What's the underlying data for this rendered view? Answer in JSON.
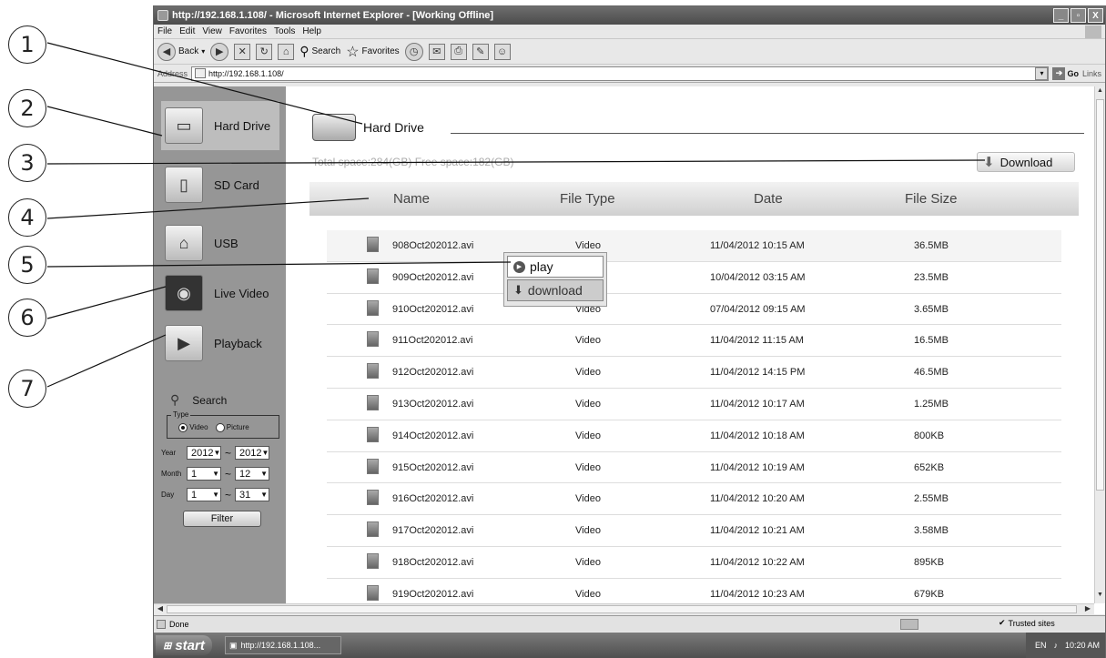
{
  "callouts": [
    "1",
    "2",
    "3",
    "4",
    "5",
    "6",
    "7"
  ],
  "window": {
    "title": "http://192.168.1.108/ - Microsoft Internet Explorer - [Working Offline]",
    "buttons": {
      "minimize": "_",
      "maximize": "▫",
      "close": "X"
    }
  },
  "menu": [
    "File",
    "Edit",
    "View",
    "Favorites",
    "Tools",
    "Help"
  ],
  "toolbar": {
    "back": "Back",
    "search": "Search",
    "favorites": "Favorites"
  },
  "address": {
    "label": "Address",
    "url": "http://192.168.1.108/",
    "go": "Go",
    "links": "Links"
  },
  "sidebar": {
    "items": [
      {
        "label": "Hard Drive",
        "icon": "hard-drive-icon"
      },
      {
        "label": "SD Card",
        "icon": "sd-card-icon"
      },
      {
        "label": "USB",
        "icon": "usb-icon"
      },
      {
        "label": "Live Video",
        "icon": "live-video-icon"
      },
      {
        "label": "Playback",
        "icon": "playback-icon"
      }
    ],
    "search": {
      "label": "Search",
      "type_legend": "Type",
      "type_options": [
        "Video",
        "Picture"
      ],
      "type_selected": "Video",
      "year_label": "Year",
      "year_from": "2012",
      "year_to": "2012",
      "month_label": "Month",
      "month_from": "1",
      "month_to": "12",
      "day_label": "Day",
      "day_from": "1",
      "day_to": "31",
      "range_sep": "~",
      "filter": "Filter"
    }
  },
  "main": {
    "title": "Hard Drive",
    "space": "Total space:284(GB) Free space:182(GB)",
    "download": "Download",
    "columns": [
      "Name",
      "File Type",
      "Date",
      "File Size"
    ],
    "rows": [
      {
        "name": "908Oct202012.avi",
        "type": "Video",
        "date": "11/04/2012 10:15 AM",
        "size": "36.5MB"
      },
      {
        "name": "909Oct202012.avi",
        "type": "Video",
        "date": "10/04/2012 03:15 AM",
        "size": "23.5MB"
      },
      {
        "name": "910Oct202012.avi",
        "type": "Video",
        "date": "07/04/2012 09:15 AM",
        "size": "3.65MB"
      },
      {
        "name": "911Oct202012.avi",
        "type": "Video",
        "date": "11/04/2012 11:15 AM",
        "size": "16.5MB"
      },
      {
        "name": "912Oct202012.avi",
        "type": "Video",
        "date": "11/04/2012 14:15 PM",
        "size": "46.5MB"
      },
      {
        "name": "913Oct202012.avi",
        "type": "Video",
        "date": "11/04/2012 10:17 AM",
        "size": "1.25MB"
      },
      {
        "name": "914Oct202012.avi",
        "type": "Video",
        "date": "11/04/2012 10:18 AM",
        "size": "800KB"
      },
      {
        "name": "915Oct202012.avi",
        "type": "Video",
        "date": "11/04/2012 10:19 AM",
        "size": "652KB"
      },
      {
        "name": "916Oct202012.avi",
        "type": "Video",
        "date": "11/04/2012 10:20 AM",
        "size": "2.55MB"
      },
      {
        "name": "917Oct202012.avi",
        "type": "Video",
        "date": "11/04/2012 10:21 AM",
        "size": "3.58MB"
      },
      {
        "name": "918Oct202012.avi",
        "type": "Video",
        "date": "11/04/2012 10:22 AM",
        "size": "895KB"
      },
      {
        "name": "919Oct202012.avi",
        "type": "Video",
        "date": "11/04/2012 10:23 AM",
        "size": "679KB"
      }
    ],
    "context_menu": {
      "play": "play",
      "download": "download"
    }
  },
  "status": {
    "text": "Done",
    "zone": "Trusted sites"
  },
  "taskbar": {
    "start": "start",
    "item": "http://192.168.1.108...",
    "lang": "EN",
    "time": "10:20 AM"
  }
}
